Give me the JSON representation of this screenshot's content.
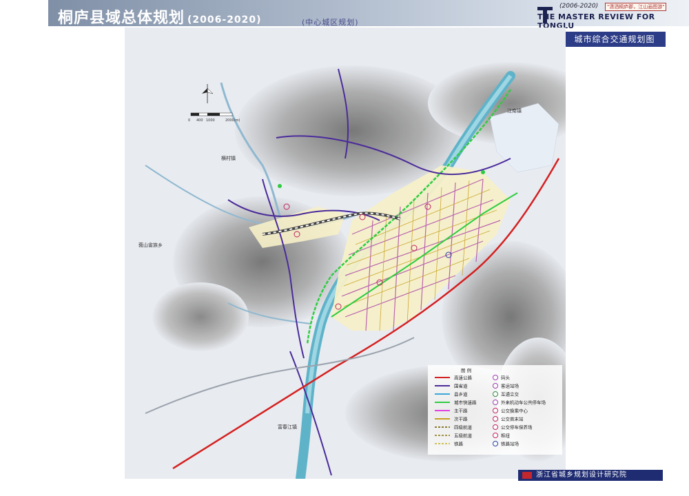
{
  "header": {
    "title": "桐庐县域总体规划",
    "years": "(2006-2020)",
    "subtitle": "(中心城区规划)",
    "brand_years": "(2006-2020)",
    "brand_slogan": "\"潇洒桐庐郡，江山画图游\"",
    "brand_en": "THE MASTER REVIEW FOR TONGLU"
  },
  "map": {
    "title": "城市综合交通规划图",
    "scale_labels": [
      "0",
      "400",
      "1000",
      "2000(m)"
    ],
    "places": {
      "hengcun": "横村镇",
      "fengshan": "莪山畲族乡",
      "dongxijiang": "富春江镇",
      "jiangnan": "江南镇"
    },
    "colors": {
      "highway": "#d42020",
      "national_road": "#4a2a9a",
      "provincial_road": "#3aa6d8",
      "expressway": "#2ecc40",
      "trunk": "#e040e0",
      "secondary": "#c8a020",
      "railway": "#444444",
      "river": "#5fb3c9",
      "urban": "#f6f0c8"
    }
  },
  "legend": {
    "title": "图  例",
    "left": [
      {
        "label": "高速公路",
        "color": "#d42020",
        "style": "solid"
      },
      {
        "label": "国省道",
        "color": "#4a2a9a",
        "style": "solid"
      },
      {
        "label": "县乡道",
        "color": "#3aa6d8",
        "style": "solid"
      },
      {
        "label": "城市快速路",
        "color": "#2ecc40",
        "style": "solid"
      },
      {
        "label": "主干路",
        "color": "#e040e0",
        "style": "solid"
      },
      {
        "label": "次干路",
        "color": "#c8a020",
        "style": "solid"
      },
      {
        "label": "四级航道",
        "color": "#8a7a30",
        "style": "dashed"
      },
      {
        "label": "五级航道",
        "color": "#a09040",
        "style": "dashed"
      },
      {
        "label": "铁路",
        "color": "#d0c050",
        "style": "dashed"
      }
    ],
    "right": [
      {
        "label": "码头",
        "color": "#9b3bb0"
      },
      {
        "label": "客运站场",
        "color": "#9b3bb0"
      },
      {
        "label": "互通立交",
        "color": "#2e8b3a"
      },
      {
        "label": "外来机动车公共停车场",
        "color": "#9b3bb0"
      },
      {
        "label": "公交换乘中心",
        "color": "#c02060"
      },
      {
        "label": "公交首末站",
        "color": "#c02060"
      },
      {
        "label": "公交停车保养场",
        "color": "#c02060"
      },
      {
        "label": "枢纽",
        "color": "#c02060"
      },
      {
        "label": "铁路站场",
        "color": "#2040a0"
      }
    ]
  },
  "footer": {
    "org": "浙江省城乡规划设计研究院"
  }
}
